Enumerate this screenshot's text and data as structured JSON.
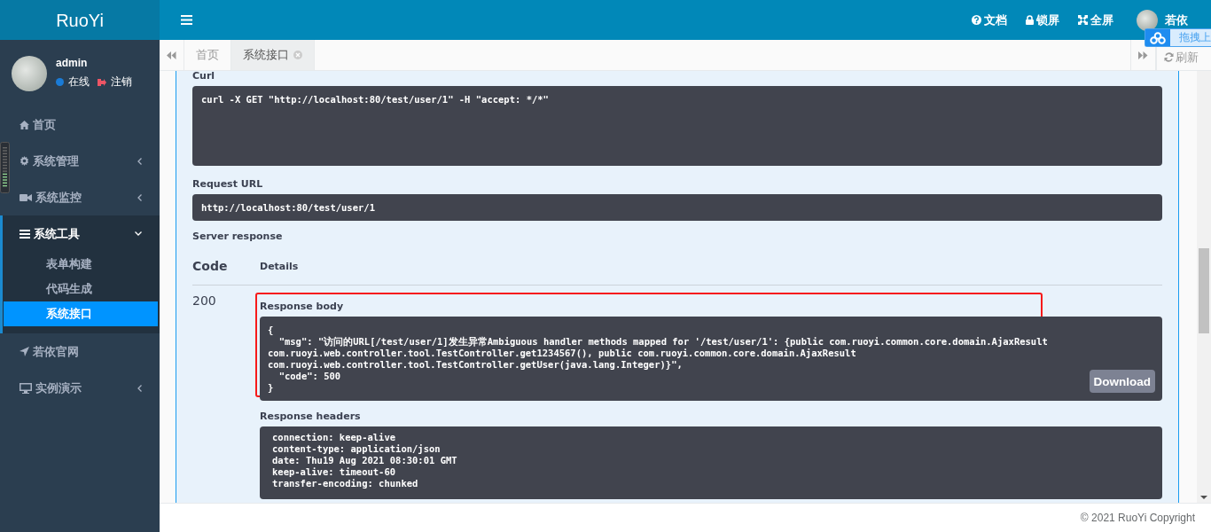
{
  "sidebar": {
    "logo": "RuoYi",
    "user": {
      "name": "admin",
      "status": "在线",
      "logout": "注销"
    },
    "menu": [
      {
        "label": "首页",
        "kind": "home",
        "selected": false
      },
      {
        "label": "系统管理",
        "kind": "gear",
        "selected": false,
        "expanded": false
      },
      {
        "label": "系统监控",
        "kind": "video",
        "selected": false,
        "expanded": false
      },
      {
        "label": "系统工具",
        "kind": "bars",
        "selected": false,
        "expanded": true,
        "children": [
          {
            "label": "表单构建",
            "selected": false
          },
          {
            "label": "代码生成",
            "selected": false
          },
          {
            "label": "系统接口",
            "selected": true
          }
        ]
      },
      {
        "label": "若依官网",
        "kind": "plane",
        "selected": false
      },
      {
        "label": "实例演示",
        "kind": "monitor",
        "selected": false,
        "expanded": false
      }
    ]
  },
  "header": {
    "actions": [
      {
        "kind": "question",
        "label": "文档"
      },
      {
        "kind": "lock",
        "label": "锁屏"
      },
      {
        "kind": "expand",
        "label": "全屏"
      }
    ],
    "user_name": "若依"
  },
  "upload_widget": {
    "label": "拖拽上"
  },
  "tabs": {
    "items": [
      {
        "label": "首页",
        "selected": false,
        "closable": false
      },
      {
        "label": "系统接口",
        "selected": true,
        "closable": true
      }
    ],
    "refresh": "刷新"
  },
  "content": {
    "curl": {
      "label": "Curl",
      "lines": [
        "curl -X GET \"http://localhost:80/test/user/1\" -H \"accept: */*\""
      ]
    },
    "request_url": {
      "label": "Request URL",
      "value": "http://localhost:80/test/user/1"
    },
    "server_response": {
      "label": "Server response",
      "columns": [
        "Code",
        "Details"
      ],
      "rows": [
        {
          "code": "200",
          "body_label": "Response body",
          "highlighted": true,
          "body_lines": [
            "{",
            "  \"msg\": \"访问的URL[/test/user/1]发生异常Ambiguous handler methods mapped for '/test/user/1': {public com.ruoyi.common.core.domain.AjaxResult",
            "com.ruoyi.web.controller.tool.TestController.get1234567(), public com.ruoyi.common.core.domain.AjaxResult",
            "com.ruoyi.web.controller.tool.TestController.getUser(java.lang.Integer)}\",",
            "  \"code\": 500",
            "}"
          ],
          "download": "Download",
          "headers_label": "Response headers",
          "header_lines": [
            "connection: keep-alive",
            "content-type: application/json",
            "date: Thu19 Aug 2021 08:30:01 GMT",
            "keep-alive: timeout-60",
            "transfer-encoding: chunked"
          ]
        }
      ]
    }
  },
  "footer": "© 2021 RuoYi Copyright"
}
